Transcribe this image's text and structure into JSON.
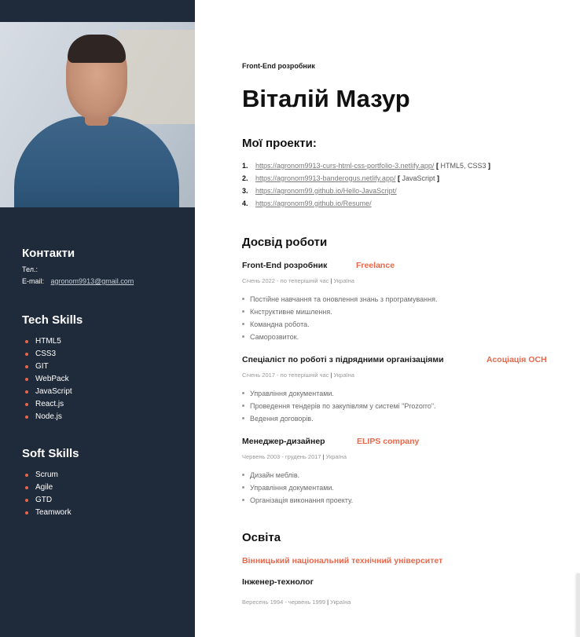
{
  "sidebar": {
    "contacts": {
      "heading": "Контакти",
      "phone_label": "Тел.:",
      "email_label": "E-mail:",
      "email": "agronom9913@gmail.com"
    },
    "tech_skills": {
      "heading": "Tech Skills",
      "items": [
        "HTML5",
        "CSS3",
        "GIT",
        "WebPack",
        "JavaScript",
        "React.js",
        "Node.js"
      ]
    },
    "soft_skills": {
      "heading": "Soft Skills",
      "items": [
        "Scrum",
        "Agile",
        "GTD",
        "Teamwork"
      ]
    }
  },
  "main": {
    "role": "Front-End розробник",
    "name": "Віталій Мазур",
    "projects": {
      "heading": "Мої проекти:",
      "items": [
        {
          "num": "1.",
          "url": "https://agronom9913-curs-html-css-portfolio-3.netlify.app/",
          "tech": "HTML5, CSS3"
        },
        {
          "num": "2.",
          "url": "https://agronom9913-banderogus.netlify.app/",
          "tech": "JavaScript"
        },
        {
          "num": "3.",
          "url": "https://agronom99.github.io/Hello-JavaScript/",
          "tech": ""
        },
        {
          "num": "4.",
          "url": "https://agronom99.github.io/Resume/",
          "tech": ""
        }
      ]
    },
    "experience": {
      "heading": "Досвід роботи",
      "jobs": [
        {
          "title": "Front-End розробник",
          "company": "Freelance",
          "period": "Січень 2022 - по теперішній час",
          "country": "Україна",
          "duties": [
            "Постійне навчання та оновлення знань з програмування.",
            "Кнструктивне мишлення.",
            "Командна робота.",
            "Саморозвиток."
          ]
        },
        {
          "title": "Спеціаліст по роботі з підрядними організаціями",
          "company": "Асоціація ОСН",
          "period": "Січень 2017 - по теперішній час",
          "country": "Україна",
          "duties": [
            "Управління документами.",
            "Проведення тендерів по закупівлям у системі \"Prozorro\".",
            "Ведення договорів."
          ]
        },
        {
          "title": "Менеджер-дизайнер",
          "company": "ELIPS company",
          "period": "Червень 2003 - грудень 2017",
          "country": "Україна",
          "duties": [
            "Дизайн меблів.",
            "Управління документами.",
            "Організація виконання проекту."
          ]
        }
      ]
    },
    "education": {
      "heading": "Освіта",
      "university": "Вінницький національний технічний університет",
      "degree": "Інженер-технолог",
      "period": "Вересень 1994 - червень 1999",
      "country": "Україна"
    },
    "separator": "|"
  },
  "colors": {
    "sidebar_bg": "#1f2b3b",
    "accent": "#e8674b"
  }
}
